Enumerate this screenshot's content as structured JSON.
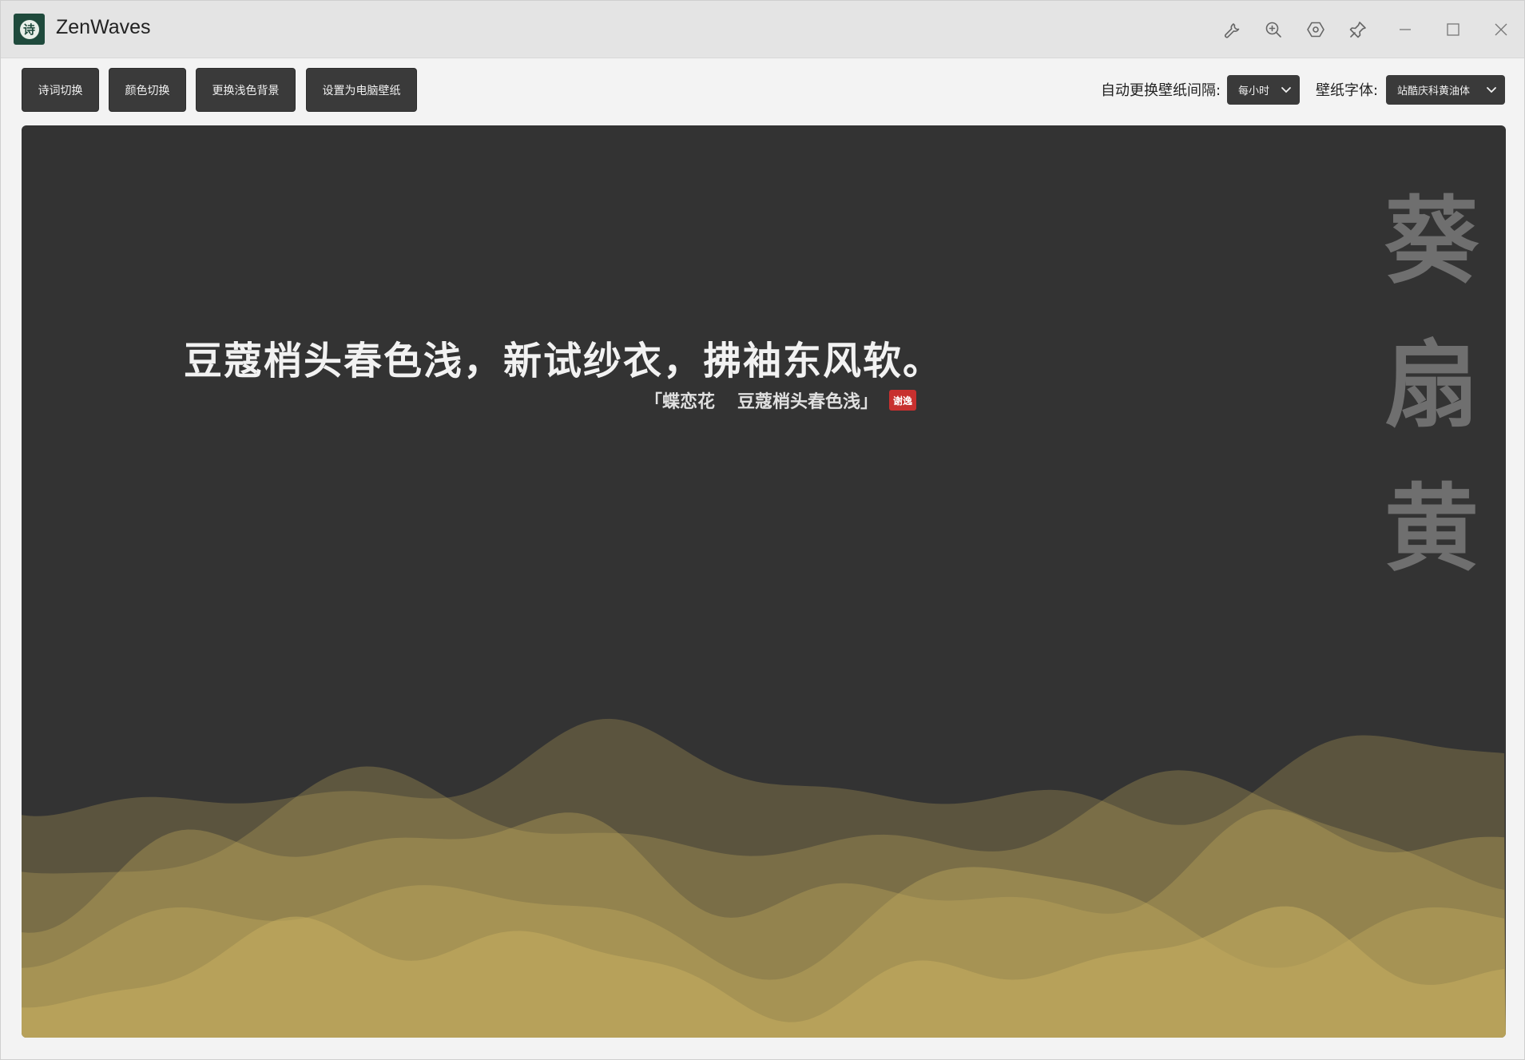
{
  "titlebar": {
    "title": "ZenWaves",
    "logo_char": "诗",
    "icons": [
      "wrench-icon",
      "zoom-in-icon",
      "settings-hex-icon",
      "pin-icon",
      "minimize-icon",
      "maximize-icon",
      "close-icon"
    ]
  },
  "toolbar": {
    "buttons": [
      "诗词切换",
      "颜色切换",
      "更换浅色背景",
      "设置为电脑壁纸"
    ],
    "interval_label": "自动更换壁纸间隔:",
    "interval_value": "每小时",
    "font_label": "壁纸字体:",
    "font_value": "站酷庆科黄油体"
  },
  "wallpaper": {
    "background_color": "#333333",
    "poem_line": "豆蔻梢头春色浅，新试纱衣，拂袖东风软。",
    "source_open": "「",
    "source_title": "蝶恋花",
    "source_first_line": "豆蔻梢头春色浅",
    "source_close": "」",
    "seal_text": "谢逸",
    "color_name": [
      "葵",
      "扇",
      "黄"
    ],
    "wave_color": "#c4ad5e"
  }
}
